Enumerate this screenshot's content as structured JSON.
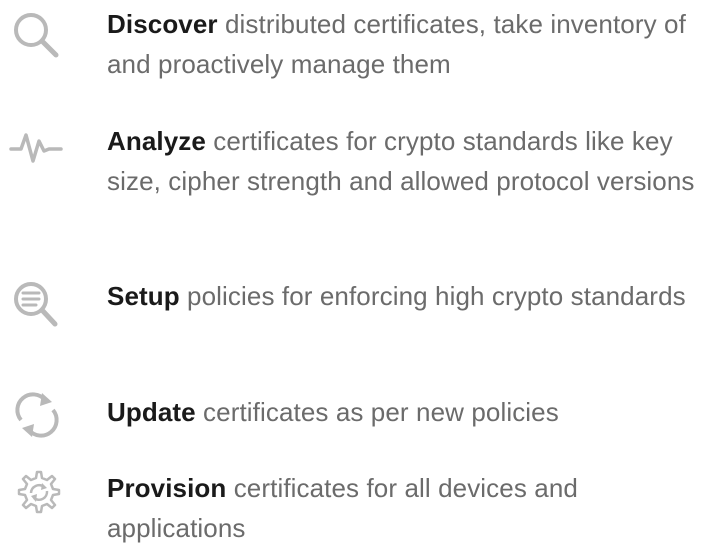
{
  "features": [
    {
      "icon": "search-icon",
      "bold": "Discover",
      "text": " distributed certificates, take inventory of and proactively manage them"
    },
    {
      "icon": "pulse-icon",
      "bold": "Analyze",
      "text": " certificates for crypto standards like key size, cipher strength and allowed protocol versions"
    },
    {
      "icon": "search-list-icon",
      "bold": "Setup",
      "text": " policies for enforcing high crypto standards"
    },
    {
      "icon": "refresh-icon",
      "bold": "Update",
      "text": " certificates as per new policies"
    },
    {
      "icon": "gear-sync-icon",
      "bold": "Provision",
      "text": " certificates for all devices and applications"
    }
  ],
  "colors": {
    "icon": "#b9b9b9",
    "body_text": "#6b6b6b",
    "bold_text": "#1a1a1a"
  }
}
